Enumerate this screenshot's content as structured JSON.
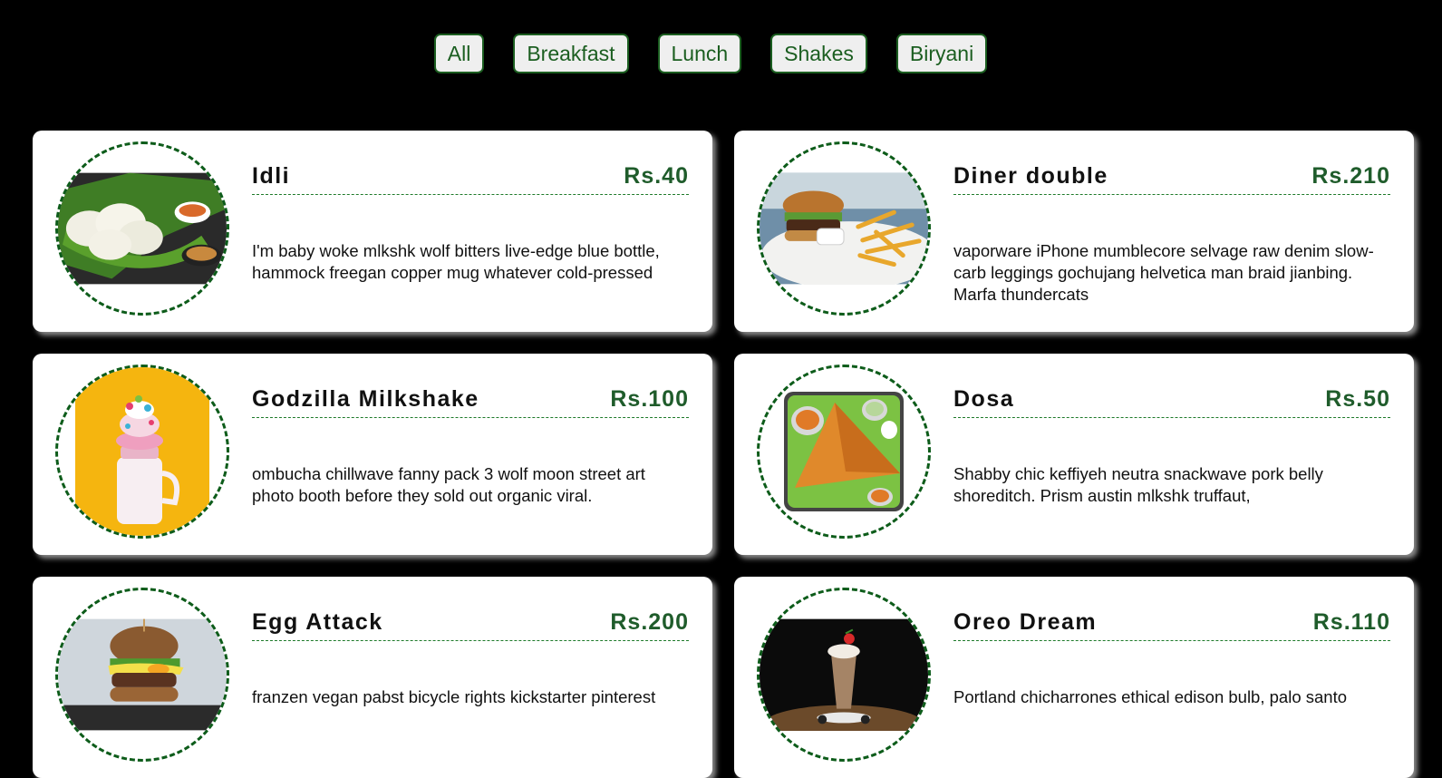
{
  "filters": [
    "All",
    "Breakfast",
    "Lunch",
    "Shakes",
    "Biryani"
  ],
  "menu": [
    {
      "name": "Idli",
      "price": "Rs.40",
      "desc": "I'm baby woke mlkshk wolf bitters live-edge blue bottle, hammock freegan copper mug whatever cold-pressed"
    },
    {
      "name": "Diner double",
      "price": "Rs.210",
      "desc": "vaporware iPhone mumblecore selvage raw denim slow-carb leggings gochujang helvetica man braid jianbing. Marfa thundercats"
    },
    {
      "name": "Godzilla Milkshake",
      "price": "Rs.100",
      "desc": "ombucha chillwave fanny pack 3 wolf moon street art photo booth before they sold out organic viral."
    },
    {
      "name": "Dosa",
      "price": "Rs.50",
      "desc": "Shabby chic keffiyeh neutra snackwave pork belly shoreditch. Prism austin mlkshk truffaut,"
    },
    {
      "name": "Egg Attack",
      "price": "Rs.200",
      "desc": "franzen vegan pabst bicycle rights kickstarter pinterest"
    },
    {
      "name": "Oreo Dream",
      "price": "Rs.110",
      "desc": "Portland chicharrones ethical edison bulb, palo santo"
    }
  ],
  "colors": {
    "accent": "#1b5e20",
    "background": "#000000",
    "card": "#ffffff"
  }
}
